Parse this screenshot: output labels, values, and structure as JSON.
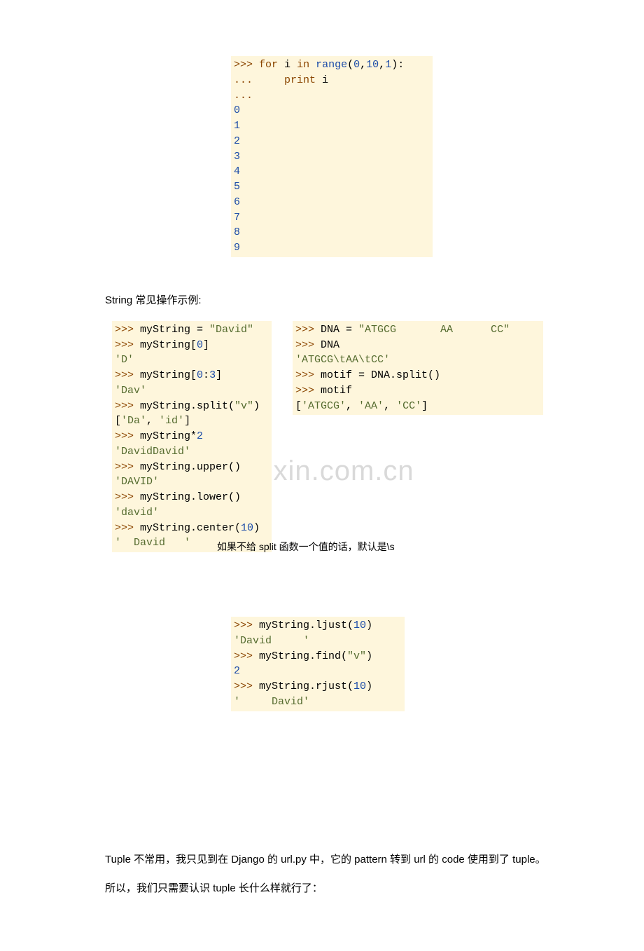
{
  "code1": ">>> for i in range(0,10,1):\n...     print i\n...\n0\n1\n2\n3\n4\n5\n6\n7\n8\n9",
  "para1": "String 常见操作示例:",
  "codeLeft": ">>> myString = \"David\"\n>>> myString[0]\n'D'\n>>> myString[0:3]\n'Dav'\n>>> myString.split(\"v\")\n['Da', 'id']\n>>> myString*2\n'DavidDavid'\n>>> myString.upper()\n'DAVID'\n>>> myString.lower()\n'david'\n>>> myString.center(10)\n'  David   '",
  "codeRight": ">>> DNA = \"ATGCG       AA      CC\"\n>>> DNA\n'ATGCG\\tAA\\tCC'\n>>> motif = DNA.split()\n>>> motif\n['ATGCG', 'AA', 'CC']",
  "note1": "如果不给 split 函数一个值的话，默认是\\s",
  "code3": ">>> myString.ljust(10)\n'David     '\n>>> myString.find(\"v\")\n2\n>>> myString.rjust(10)\n'     David'",
  "para2": "Tuple 不常用，我只见到在 Django 的 url.py 中，它的 pattern 转到 url 的 code 使用到了 tuple。",
  "para3": "所以，我们只需要认识 tuple 长什么样就行了：",
  "watermark": "www.zixin.com.cn"
}
